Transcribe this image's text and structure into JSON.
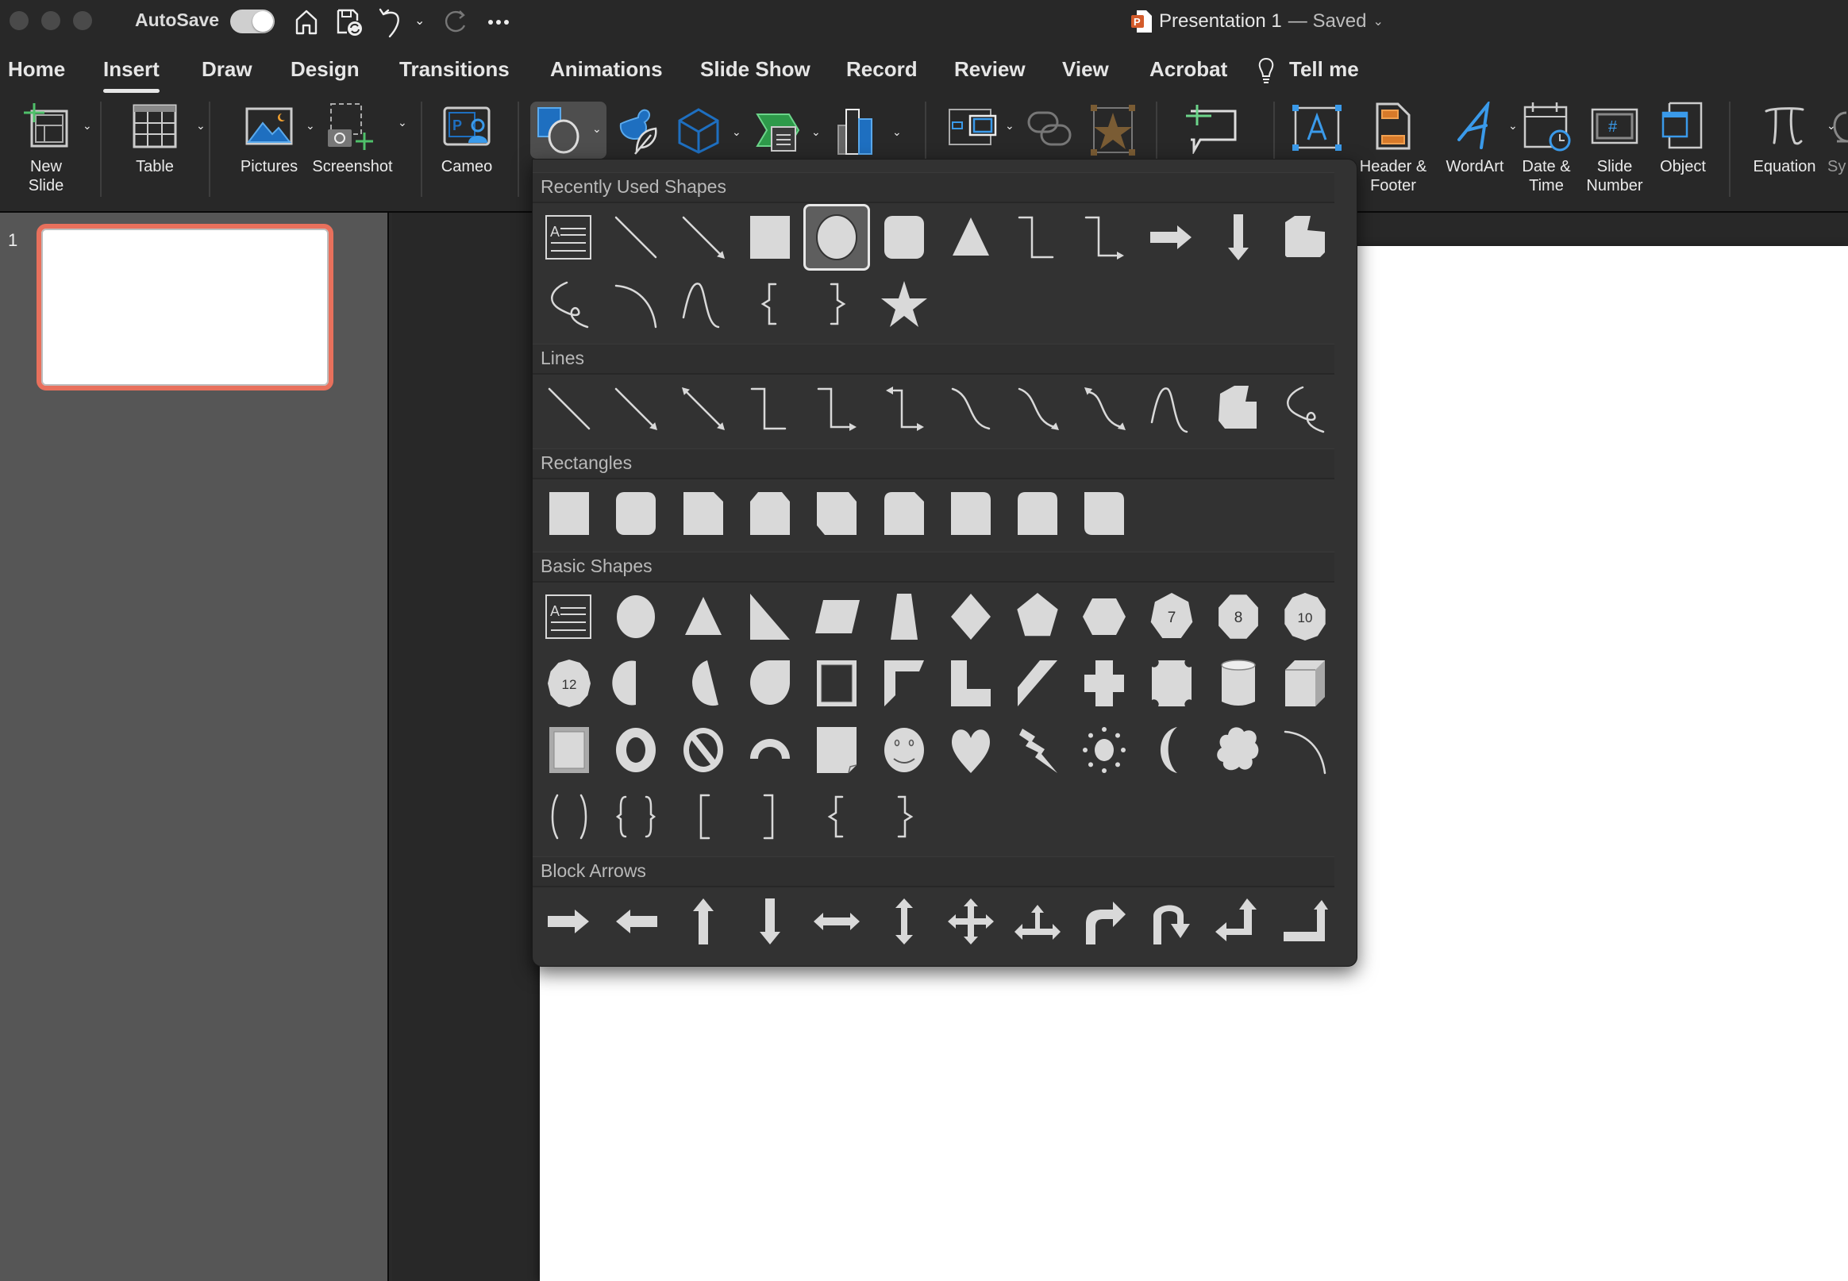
{
  "window": {
    "autosave_label": "AutoSave",
    "autosave_on": true,
    "doc_title": "Presentation 1",
    "doc_status": "— Saved",
    "toolbar_icons": [
      "home-icon",
      "save-icon",
      "undo-icon",
      "undo-dropdown-icon",
      "redo-icon",
      "more-icon"
    ]
  },
  "tabs": [
    {
      "label": "Home",
      "active": false
    },
    {
      "label": "Insert",
      "active": true
    },
    {
      "label": "Draw",
      "active": false
    },
    {
      "label": "Design",
      "active": false
    },
    {
      "label": "Transitions",
      "active": false
    },
    {
      "label": "Animations",
      "active": false
    },
    {
      "label": "Slide Show",
      "active": false
    },
    {
      "label": "Record",
      "active": false
    },
    {
      "label": "Review",
      "active": false
    },
    {
      "label": "View",
      "active": false
    },
    {
      "label": "Acrobat",
      "active": false
    },
    {
      "label": "Tell me",
      "active": false
    }
  ],
  "ribbon": {
    "new_slide": "New\nSlide",
    "table": "Table",
    "pictures": "Pictures",
    "screenshot": "Screenshot",
    "cameo": "Cameo",
    "header_footer": "Header &\nFooter",
    "wordart": "WordArt",
    "date_time": "Date &\nTime",
    "slide_number": "Slide\nNumber",
    "object": "Object",
    "equation": "Equation",
    "symbol": "Sy"
  },
  "slides_panel": {
    "slides": [
      {
        "number": "1",
        "selected": true
      }
    ]
  },
  "shapes_menu": {
    "sections": [
      {
        "title": "Recently Used Shapes",
        "rows": [
          [
            "textbox",
            "line",
            "line-arrow",
            "rect",
            "oval",
            "rounded-rect",
            "triangle",
            "elbow",
            "elbow-arrow",
            "right-arrow",
            "down-arrow",
            "snip-corner"
          ],
          [
            "scribble",
            "arc",
            "freeform-curve",
            "left-brace",
            "right-brace",
            "star"
          ]
        ],
        "selected": "oval"
      },
      {
        "title": "Lines",
        "rows": [
          [
            "line",
            "line-arrow",
            "line-double-arrow",
            "elbow",
            "elbow-arrow",
            "elbow-double-arrow",
            "curve",
            "curve-arrow",
            "curve-double-arrow",
            "freeform-curve",
            "freeform-shape",
            "scribble"
          ]
        ]
      },
      {
        "title": "Rectangles",
        "rows": [
          [
            "rect",
            "rounded-rect",
            "snip-single",
            "snip-same",
            "snip-diagonal",
            "snip-round",
            "round-single",
            "round-same",
            "round-diagonal"
          ]
        ]
      },
      {
        "title": "Basic Shapes",
        "rows": [
          [
            "textbox",
            "oval",
            "triangle",
            "right-triangle",
            "parallelogram",
            "trapezoid",
            "diamond",
            "pentagon",
            "hexagon",
            "heptagon",
            "octagon",
            "decagon"
          ],
          [
            "dodecagon",
            "pie",
            "chord",
            "teardrop",
            "frame",
            "half-frame",
            "l-shape",
            "diagonal-stripe",
            "cross",
            "plaque",
            "can",
            "cube"
          ],
          [
            "bevel",
            "donut",
            "no-symbol",
            "block-arc",
            "folded-corner",
            "smiley",
            "heart",
            "lightning",
            "sun",
            "moon",
            "cloud",
            "arc"
          ],
          [
            "double-bracket",
            "double-brace",
            "left-bracket",
            "right-bracket",
            "left-brace",
            "right-brace"
          ]
        ]
      },
      {
        "title": "Block Arrows",
        "rows": [
          [
            "right-arrow",
            "left-arrow",
            "up-arrow",
            "down-arrow",
            "left-right-arrow",
            "up-down-arrow",
            "quad-arrow",
            "left-right-up-arrow",
            "bent-arrow",
            "u-turn-arrow",
            "left-up-arrow",
            "bent-up-arrow"
          ]
        ]
      }
    ],
    "polygon_labels": {
      "heptagon": "7",
      "octagon": "8",
      "decagon": "10",
      "dodecagon": "12"
    }
  },
  "colors": {
    "accent_thumb_border": "#e8705c",
    "ribbon_blue": "#1e6fc0",
    "ribbon_green": "#3cb45a",
    "shape_fill": "#d9d9d9"
  }
}
